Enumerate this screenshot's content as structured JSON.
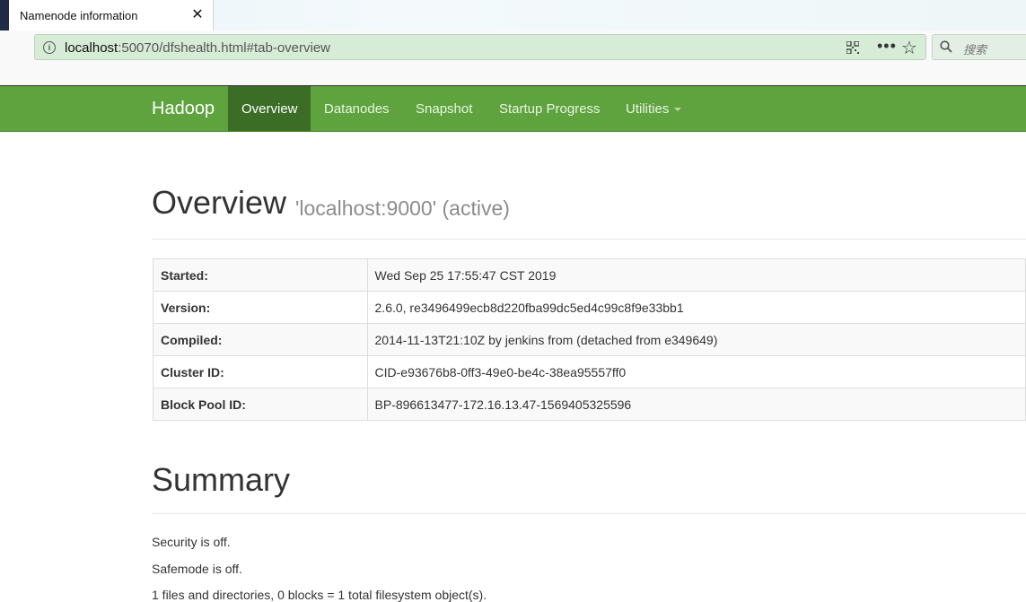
{
  "browser": {
    "tab_title": "Namenode information",
    "tab_close": "✕",
    "url_host": "localhost",
    "url_rest": ":50070/dfshealth.html#tab-overview",
    "more": "•••",
    "star": "☆",
    "search_placeholder": "搜索"
  },
  "navbar": {
    "brand": "Hadoop",
    "items": [
      {
        "label": "Overview",
        "active": true
      },
      {
        "label": "Datanodes",
        "active": false
      },
      {
        "label": "Snapshot",
        "active": false
      },
      {
        "label": "Startup Progress",
        "active": false
      },
      {
        "label": "Utilities",
        "active": false,
        "dropdown": true
      }
    ],
    "bg_color": "#5fa33e",
    "active_color": "#3b6d26"
  },
  "overview": {
    "title": "Overview",
    "subtitle": "'localhost:9000' (active)",
    "rows": [
      {
        "key": "Started:",
        "value": "Wed Sep 25 17:55:47 CST 2019"
      },
      {
        "key": "Version:",
        "value": "2.6.0, re3496499ecb8d220fba99dc5ed4c99c8f9e33bb1"
      },
      {
        "key": "Compiled:",
        "value": "2014-11-13T21:10Z by jenkins from (detached from e349649)"
      },
      {
        "key": "Cluster ID:",
        "value": "CID-e93676b8-0ff3-49e0-be4c-38ea95557ff0"
      },
      {
        "key": "Block Pool ID:",
        "value": "BP-896613477-172.16.13.47-1569405325596"
      }
    ]
  },
  "summary": {
    "title": "Summary",
    "lines": [
      "Security is off.",
      "Safemode is off.",
      "1 files and directories, 0 blocks = 1 total filesystem object(s)."
    ]
  }
}
